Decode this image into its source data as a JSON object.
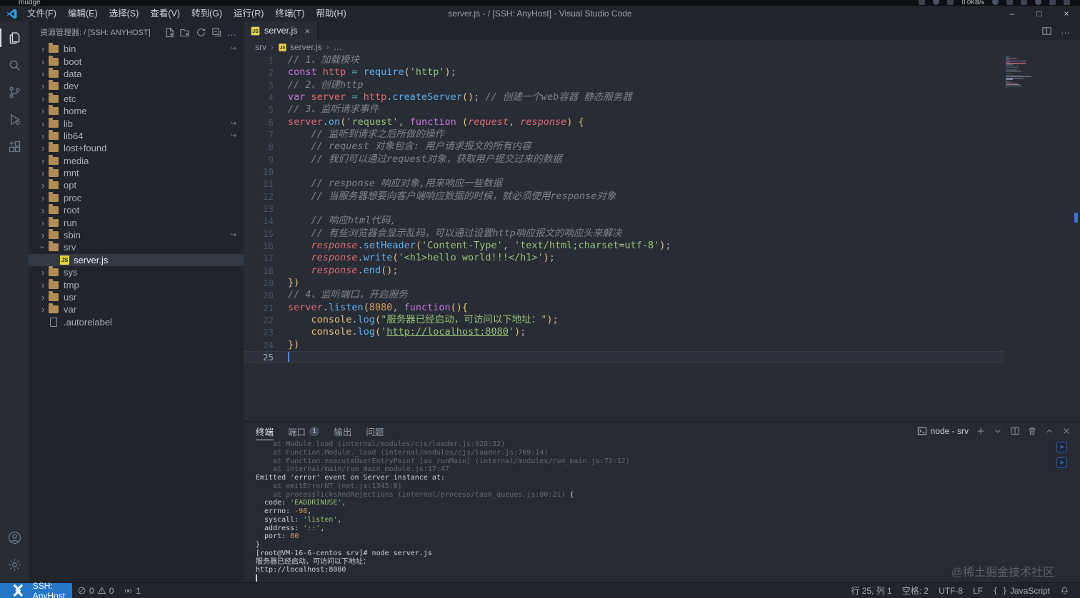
{
  "tray": {
    "left": "mudge",
    "net": "0.0KB/s"
  },
  "title_bar": {
    "menus": [
      "文件(F)",
      "编辑(E)",
      "选择(S)",
      "查看(V)",
      "转到(G)",
      "运行(R)",
      "终端(T)",
      "帮助(H)"
    ],
    "title": "server.js - / [SSH: AnyHost] - Visual Studio Code"
  },
  "sidebar": {
    "header": "资源管理器: / [SSH: ANYHOST]",
    "tree": [
      {
        "label": "bin",
        "symlink": true
      },
      {
        "label": "boot"
      },
      {
        "label": "data"
      },
      {
        "label": "dev"
      },
      {
        "label": "etc"
      },
      {
        "label": "home"
      },
      {
        "label": "lib",
        "symlink": true
      },
      {
        "label": "lib64",
        "symlink": true
      },
      {
        "label": "lost+found"
      },
      {
        "label": "media"
      },
      {
        "label": "mnt"
      },
      {
        "label": "opt"
      },
      {
        "label": "proc"
      },
      {
        "label": "root"
      },
      {
        "label": "run"
      },
      {
        "label": "sbin",
        "symlink": true
      },
      {
        "label": "srv",
        "expanded": true
      },
      {
        "label": "server.js",
        "type": "file-js",
        "depth": 1,
        "selected": true
      },
      {
        "label": "sys"
      },
      {
        "label": "tmp"
      },
      {
        "label": "usr"
      },
      {
        "label": "var"
      },
      {
        "label": ".autorelabel",
        "type": "file"
      }
    ]
  },
  "editor": {
    "tab": {
      "label": "server.js"
    },
    "breadcrumbs": [
      "srv",
      "server.js",
      "…"
    ],
    "cursor_line": 25,
    "lines": [
      {
        "n": 1,
        "s": [
          [
            "cm",
            "// 1、加载模块"
          ]
        ]
      },
      {
        "n": 2,
        "s": [
          [
            "kw",
            "const"
          ],
          [
            "pn",
            " "
          ],
          [
            "vr",
            "http"
          ],
          [
            "op",
            " = "
          ],
          [
            "fn",
            "require"
          ],
          [
            "br",
            "("
          ],
          [
            "st",
            "'http'"
          ],
          [
            "br",
            ")"
          ],
          [
            "pn",
            ";"
          ]
        ]
      },
      {
        "n": 3,
        "s": [
          [
            "cm",
            "// 2、创建http"
          ]
        ]
      },
      {
        "n": 4,
        "s": [
          [
            "kw",
            "var"
          ],
          [
            "pn",
            " "
          ],
          [
            "vr",
            "server"
          ],
          [
            "op",
            " = "
          ],
          [
            "vr",
            "http"
          ],
          [
            "pn",
            "."
          ],
          [
            "fn",
            "createServer"
          ],
          [
            "br",
            "()"
          ],
          [
            "pn",
            "; "
          ],
          [
            "cm",
            "// 创建一个web容器 静态服务器"
          ]
        ]
      },
      {
        "n": 5,
        "s": [
          [
            "cm",
            "// 3、监听请求事件"
          ]
        ]
      },
      {
        "n": 6,
        "s": [
          [
            "vr",
            "server"
          ],
          [
            "pn",
            "."
          ],
          [
            "fn",
            "on"
          ],
          [
            "br",
            "("
          ],
          [
            "st",
            "'request'"
          ],
          [
            "pn",
            ", "
          ],
          [
            "kw",
            "function"
          ],
          [
            "pn",
            " "
          ],
          [
            "br",
            "("
          ],
          [
            "pr",
            "request"
          ],
          [
            "pn",
            ", "
          ],
          [
            "pr",
            "response"
          ],
          [
            "br",
            ")"
          ],
          [
            "pn",
            " "
          ],
          [
            "br",
            "{"
          ]
        ]
      },
      {
        "n": 7,
        "s": [
          [
            "cm",
            "    // 监听到请求之后所做的操作"
          ]
        ]
      },
      {
        "n": 8,
        "s": [
          [
            "cm",
            "    // request 对象包含: 用户请求报文的所有内容"
          ]
        ]
      },
      {
        "n": 9,
        "s": [
          [
            "cm",
            "    // 我们可以通过request对象，获取用户提交过来的数据"
          ]
        ]
      },
      {
        "n": 10,
        "s": []
      },
      {
        "n": 11,
        "s": [
          [
            "cm",
            "    // response 响应对象,用来响应一些数据"
          ]
        ]
      },
      {
        "n": 12,
        "s": [
          [
            "cm",
            "    // 当服务器想要向客户端响应数据的时候，就必须使用response对象"
          ]
        ]
      },
      {
        "n": 13,
        "s": []
      },
      {
        "n": 14,
        "s": [
          [
            "cm",
            "    // 响应html代码,"
          ]
        ]
      },
      {
        "n": 15,
        "s": [
          [
            "cm",
            "    // 有些浏览器会显示乱码，可以通过设置http响应报文的响应头来解决"
          ]
        ]
      },
      {
        "n": 16,
        "s": [
          [
            "pn",
            "    "
          ],
          [
            "pr",
            "response"
          ],
          [
            "pn",
            "."
          ],
          [
            "fn",
            "setHeader"
          ],
          [
            "br",
            "("
          ],
          [
            "st",
            "'Content-Type'"
          ],
          [
            "pn",
            ", "
          ],
          [
            "st",
            "'text/html;charset=utf-8'"
          ],
          [
            "br",
            ")"
          ],
          [
            "pn",
            ";"
          ]
        ]
      },
      {
        "n": 17,
        "s": [
          [
            "pn",
            "    "
          ],
          [
            "pr",
            "response"
          ],
          [
            "pn",
            "."
          ],
          [
            "fn",
            "write"
          ],
          [
            "br",
            "("
          ],
          [
            "st",
            "'<h1>hello world!!!</h1>'"
          ],
          [
            "br",
            ")"
          ],
          [
            "pn",
            ";"
          ]
        ]
      },
      {
        "n": 18,
        "s": [
          [
            "pn",
            "    "
          ],
          [
            "pr",
            "response"
          ],
          [
            "pn",
            "."
          ],
          [
            "fn",
            "end"
          ],
          [
            "br",
            "()"
          ],
          [
            "pn",
            ";"
          ]
        ]
      },
      {
        "n": 19,
        "s": [
          [
            "br",
            "})"
          ]
        ]
      },
      {
        "n": 20,
        "s": [
          [
            "cm",
            "// 4、监听端口，开启服务"
          ]
        ]
      },
      {
        "n": 21,
        "s": [
          [
            "vr",
            "server"
          ],
          [
            "pn",
            "."
          ],
          [
            "fn",
            "listen"
          ],
          [
            "br",
            "("
          ],
          [
            "nm",
            "8080"
          ],
          [
            "pn",
            ", "
          ],
          [
            "kw",
            "function"
          ],
          [
            "br",
            "(){"
          ]
        ]
      },
      {
        "n": 22,
        "s": [
          [
            "pn",
            "    "
          ],
          [
            "ob",
            "console"
          ],
          [
            "pn",
            "."
          ],
          [
            "fn",
            "log"
          ],
          [
            "br",
            "("
          ],
          [
            "st",
            "\"服务器已经启动，可访问以下地址：\""
          ],
          [
            "br",
            ")"
          ],
          [
            "pn",
            ";"
          ]
        ]
      },
      {
        "n": 23,
        "s": [
          [
            "pn",
            "    "
          ],
          [
            "ob",
            "console"
          ],
          [
            "pn",
            "."
          ],
          [
            "fn",
            "log"
          ],
          [
            "br",
            "("
          ],
          [
            "st",
            "'"
          ],
          [
            "lk",
            "http://localhost:8080"
          ],
          [
            "st",
            "'"
          ],
          [
            "br",
            ")"
          ],
          [
            "pn",
            ";"
          ]
        ]
      },
      {
        "n": 24,
        "s": [
          [
            "br",
            "})"
          ]
        ]
      },
      {
        "n": 25,
        "s": []
      }
    ]
  },
  "panel": {
    "tabs": [
      {
        "label": "终端",
        "active": true
      },
      {
        "label": "端口",
        "badge": "1"
      },
      {
        "label": "输出"
      },
      {
        "label": "问题"
      }
    ],
    "terminal_select": "node - srv",
    "terminal_lines": [
      [
        [
          "dim",
          "    at Module.load (internal/modules/cjs/loader.js:928:32)"
        ]
      ],
      [
        [
          "dim",
          "    at Function.Module._load (internal/modules/cjs/loader.js:769:14)"
        ]
      ],
      [
        [
          "dim",
          "    at Function.executeUserEntryPoint [as runMain] (internal/modules/run_main.js:72:12)"
        ]
      ],
      [
        [
          "dim",
          "    at internal/main/run_main_module.js:17:47"
        ]
      ],
      [
        [
          "t",
          "Emitted 'error' event on Server instance at:"
        ]
      ],
      [
        [
          "dim",
          "    at emitErrorNT (net.js:1345:8)"
        ]
      ],
      [
        [
          "dim",
          "    at processTicksAndRejections (internal/process/task_queues.js:80:21) "
        ],
        [
          "t",
          "{"
        ]
      ],
      [
        [
          "t",
          "  code: "
        ],
        [
          "tstr",
          "'EADDRINUSE'"
        ],
        [
          "t",
          ","
        ]
      ],
      [
        [
          "t",
          "  errno: "
        ],
        [
          "tnum",
          "-98"
        ],
        [
          "t",
          ","
        ]
      ],
      [
        [
          "t",
          "  syscall: "
        ],
        [
          "tstr",
          "'listen'"
        ],
        [
          "t",
          ","
        ]
      ],
      [
        [
          "t",
          "  address: "
        ],
        [
          "tstr",
          "'::'"
        ],
        [
          "t",
          ","
        ]
      ],
      [
        [
          "t",
          "  port: "
        ],
        [
          "tnum",
          "80"
        ]
      ],
      [
        [
          "t",
          "}"
        ]
      ],
      [
        [
          "t",
          "[root@VM-16-6-centos srv]# node server.js"
        ]
      ],
      [
        [
          "t",
          "服务器已经启动，可访问以下地址："
        ]
      ],
      [
        [
          "t",
          "http://localhost:8080"
        ]
      ],
      [
        [
          "cursor",
          ""
        ]
      ]
    ]
  },
  "status_bar": {
    "remote": "SSH: AnyHost",
    "errors": "0",
    "warnings": "0",
    "ports": "1",
    "cursor": "行 25, 列 1",
    "indent": "空格: 2",
    "encoding": "UTF-8",
    "eol": "LF",
    "language": "JavaScript"
  },
  "watermark": "@稀土掘金技术社区"
}
